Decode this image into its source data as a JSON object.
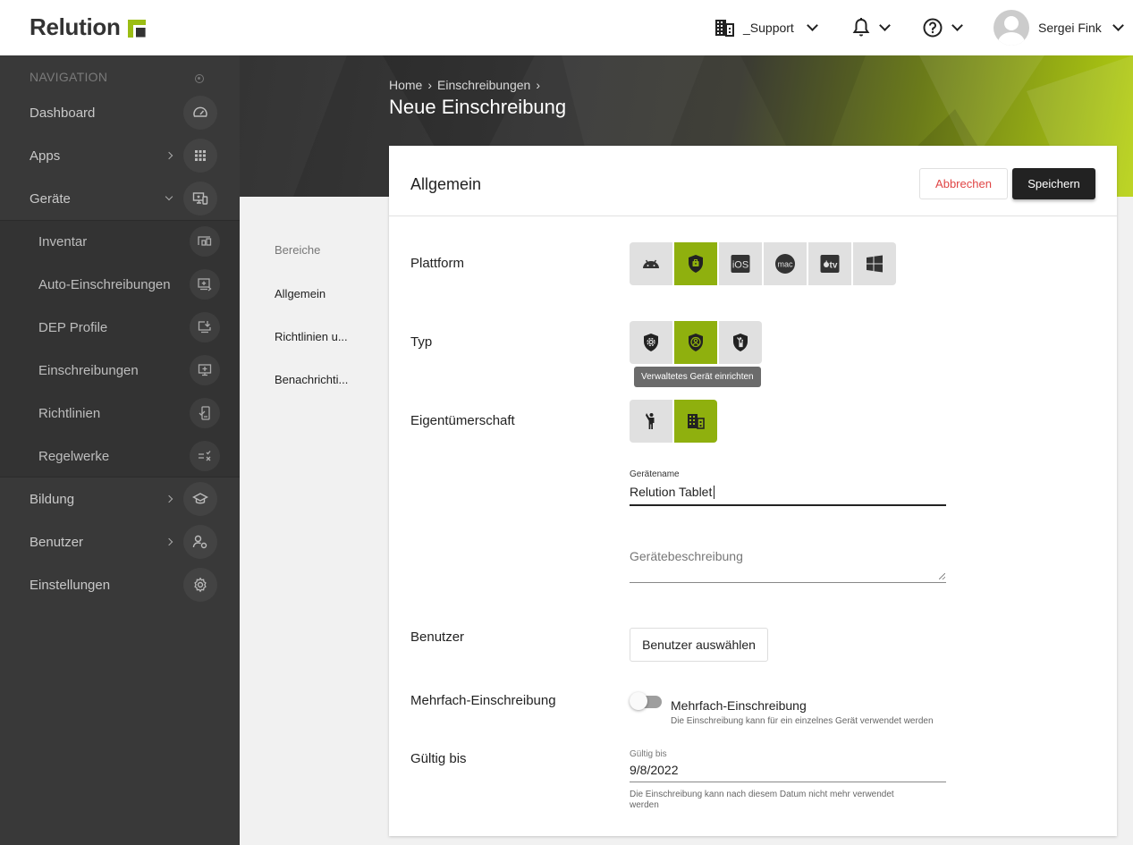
{
  "topbar": {
    "logo_text": "Relution",
    "organization": "_Support",
    "user_name": "Sergei Fink"
  },
  "sidebar": {
    "heading": "NAVIGATION",
    "items": [
      {
        "label": "Dashboard",
        "icon": "speedometer-icon"
      },
      {
        "label": "Apps",
        "icon": "grid-icon",
        "expandable": true
      },
      {
        "label": "Geräte",
        "icon": "devices-icon",
        "expanded": true
      },
      {
        "label": "Inventar",
        "icon": "inventory-icon",
        "sub": true
      },
      {
        "label": "Auto-Einschreibungen",
        "icon": "auto-enrollment-icon",
        "sub": true
      },
      {
        "label": "DEP Profile",
        "icon": "dep-profile-icon",
        "sub": true
      },
      {
        "label": "Einschreibungen",
        "icon": "enrollment-icon",
        "sub": true
      },
      {
        "label": "Richtlinien",
        "icon": "policy-icon",
        "sub": true
      },
      {
        "label": "Regelwerke",
        "icon": "ruleset-icon",
        "sub": true
      },
      {
        "label": "Bildung",
        "icon": "graduation-cap-icon",
        "expandable": true
      },
      {
        "label": "Benutzer",
        "icon": "user-settings-icon",
        "expandable": true
      },
      {
        "label": "Einstellungen",
        "icon": "gear-icon"
      }
    ]
  },
  "breadcrumb": [
    "Home",
    "Einschreibungen"
  ],
  "page_title": "Neue Einschreibung",
  "section_nav": {
    "heading": "Bereiche",
    "items": [
      "Allgemein",
      "Richtlinien u...",
      "Benachrichti..."
    ]
  },
  "card": {
    "title": "Allgemein",
    "cancel_label": "Abbrechen",
    "save_label": "Speichern"
  },
  "form": {
    "platform": {
      "label": "Plattform",
      "options": [
        "Android",
        "Android Enterprise",
        "iOS",
        "macOS",
        "tvOS",
        "Windows"
      ],
      "selected": "Android Enterprise"
    },
    "type": {
      "label": "Typ",
      "options": [
        "Geräteeinstellungen",
        "Verwaltetes Gerät einrichten",
        "Arbeitsprofil"
      ],
      "selected": "Verwaltetes Gerät einrichten",
      "tooltip": "Verwaltetes Gerät einrichten"
    },
    "ownership": {
      "label": "Eigentümerschaft",
      "options": [
        "Privat",
        "Unternehmen"
      ],
      "selected": "Unternehmen"
    },
    "device_name": {
      "label": "Gerätename",
      "value": "Relution Tablet"
    },
    "device_description": {
      "placeholder": "Gerätebeschreibung",
      "value": ""
    },
    "user": {
      "label": "Benutzer",
      "button_label": "Benutzer auswählen"
    },
    "multi_enrollment": {
      "label": "Mehrfach-Einschreibung",
      "toggle_label": "Mehrfach-Einschreibung",
      "hint": "Die Einschreibung kann für ein einzelnes Gerät verwendet werden",
      "enabled": false
    },
    "valid_until": {
      "label": "Gültig bis",
      "field_label": "Gültig bis",
      "value": "9/8/2022",
      "hint": "Die Einschreibung kann nach diesem Datum nicht mehr verwendet werden"
    }
  },
  "colors": {
    "accent": "#8fb00e",
    "sidebar_bg": "#393939",
    "danger": "#e04545",
    "primary_button": "#222222"
  }
}
